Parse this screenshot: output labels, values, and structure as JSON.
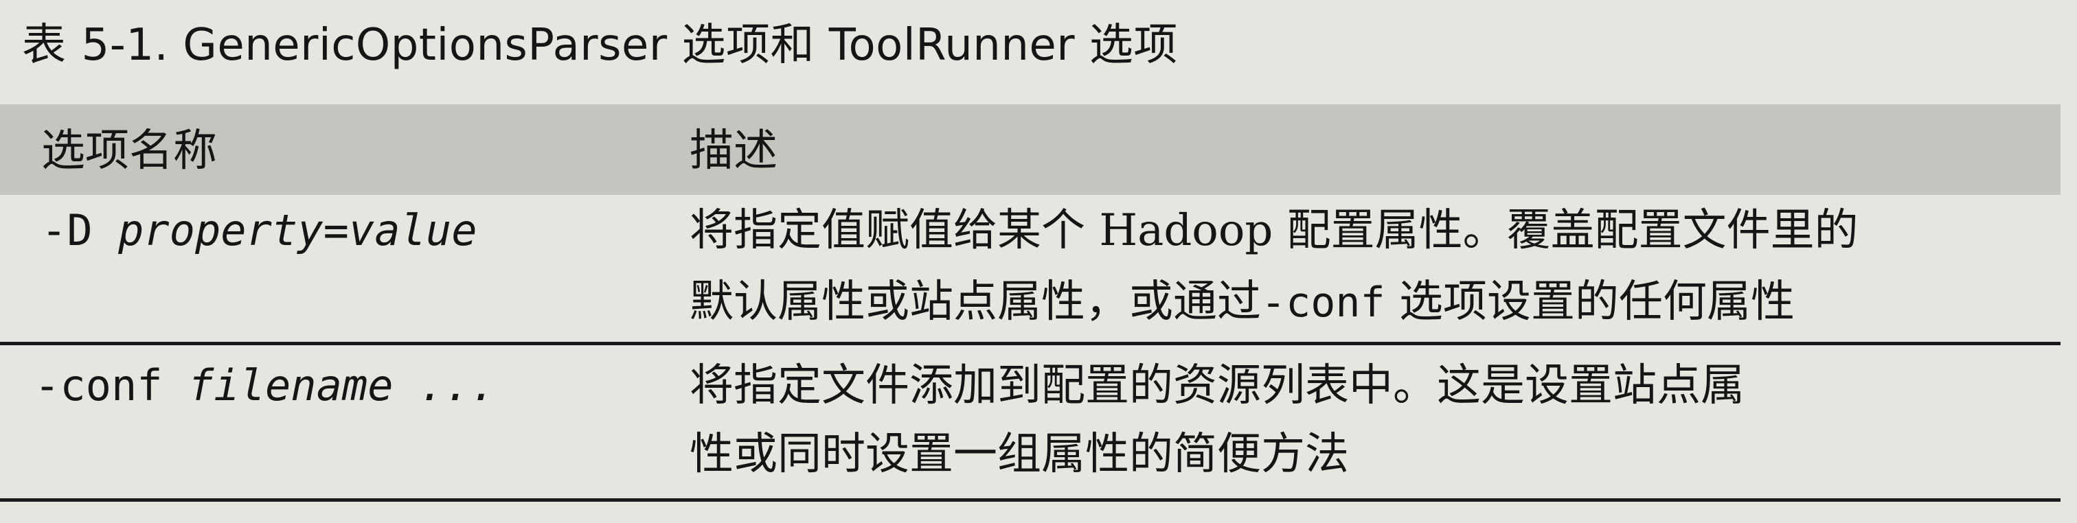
{
  "caption": {
    "label": "表",
    "number": "5-1.",
    "text": "GenericOptionsParser 选项和 ToolRunner 选项"
  },
  "table": {
    "headers": {
      "col1": "选项名称",
      "col2": "描述"
    },
    "rows": [
      {
        "option_flag": "-D",
        "option_arg": "property=value",
        "desc_line1_a": "将指定值赋值给某个 ",
        "desc_line1_latin": "Hadoop",
        "desc_line1_b": " 配置属性。覆盖配置文件里的",
        "desc_line2_a": "默认属性或站点属性，或通过",
        "desc_line2_mono": "-conf",
        "desc_line2_b": " 选项设置的任何属性"
      },
      {
        "option_flag": "-conf",
        "option_arg": "filename ...",
        "desc_line1": "将指定文件添加到配置的资源列表中。这是设置站点属",
        "desc_line2": "性或同时设置一组属性的简便方法"
      }
    ]
  }
}
